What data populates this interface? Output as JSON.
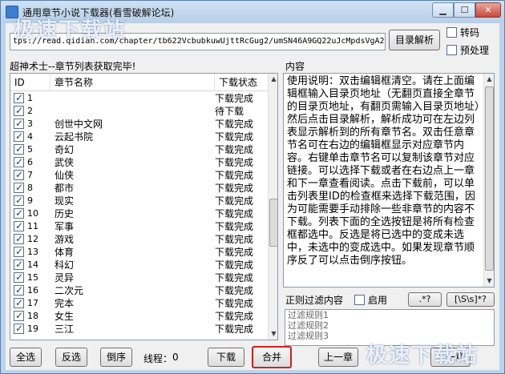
{
  "window": {
    "title": "通用章节小说下载器(看雪破解论坛)",
    "watermark": "极速下载站"
  },
  "url": {
    "value": "tps://read.qidian.com/chapter/tb622VcbubkuwUjttRcGug2/umSN46A9GQ22uJcMpdsVgA2"
  },
  "buttons": {
    "parse": "目录解析",
    "select_all": "全选",
    "invert": "反选",
    "reverse": "倒序",
    "download": "下载",
    "merge": "合并",
    "prev_chapter": "上一章",
    "next_chapter": "下一章",
    "regex_any": ".*?",
    "regex_ws": "[\\S\\s]*?"
  },
  "options": {
    "transcode": "转码",
    "preprocess": "预处理",
    "enable": "启用"
  },
  "status": {
    "message": "超神术士--章节列表获取完毕!",
    "threads_label": "线程：",
    "threads_value": "0"
  },
  "chapter_list": {
    "headers": {
      "id": "ID",
      "name": "章节名称",
      "status": "下载状态"
    },
    "rows": [
      {
        "id": "1",
        "name": "",
        "status": "下载完成",
        "checked": true
      },
      {
        "id": "2",
        "name": "",
        "status": "待下载",
        "checked": true
      },
      {
        "id": "3",
        "name": "创世中文网",
        "status": "下载完成",
        "checked": true
      },
      {
        "id": "4",
        "name": "云起书院",
        "status": "下载完成",
        "checked": true
      },
      {
        "id": "5",
        "name": "奇幻",
        "status": "下载完成",
        "checked": true
      },
      {
        "id": "6",
        "name": "武侠",
        "status": "下载完成",
        "checked": true
      },
      {
        "id": "7",
        "name": "仙侠",
        "status": "下载完成",
        "checked": true
      },
      {
        "id": "8",
        "name": "都市",
        "status": "下载完成",
        "checked": true
      },
      {
        "id": "9",
        "name": "现实",
        "status": "下载完成",
        "checked": true
      },
      {
        "id": "10",
        "name": "历史",
        "status": "下载完成",
        "checked": true
      },
      {
        "id": "11",
        "name": "军事",
        "status": "下载完成",
        "checked": true
      },
      {
        "id": "12",
        "name": "游戏",
        "status": "下载完成",
        "checked": true
      },
      {
        "id": "13",
        "name": "体育",
        "status": "下载完成",
        "checked": true
      },
      {
        "id": "14",
        "name": "科幻",
        "status": "下载完成",
        "checked": true
      },
      {
        "id": "15",
        "name": "灵异",
        "status": "下载完成",
        "checked": true
      },
      {
        "id": "16",
        "name": "二次元",
        "status": "下载完成",
        "checked": true
      },
      {
        "id": "17",
        "name": "完本",
        "status": "下载完成",
        "checked": true
      },
      {
        "id": "18",
        "name": "女生",
        "status": "下载完成",
        "checked": true
      },
      {
        "id": "19",
        "name": "三江",
        "status": "下载完成",
        "checked": true
      }
    ]
  },
  "content": {
    "label": "内容",
    "text": "使用说明：双击编辑框清空。请在上面编辑框输入目录页地址（无翻页直接全章节的目录页地址，有翻页需输入目录页地址）然后点击目录解析，解析成功可在左边列表显示解析到的所有章节名。双击任意章节名可在右边的编辑框显示对应章节内容。右键单击章节名可以复制该章节对应链接。可以选择下载或者在右边点上一章和下一章查看阅读。点击下载前，可以单击列表里ID的检查框来选择下载范围，因为可能需要手动排除一些非章节的内容不下载。列表下面的全选按钮是将所有检查框都选中。反选是将已选中的变成未选中，未选中的变成选中。如果发现章节顺序反了可以点击倒序按钮。"
  },
  "filter": {
    "label": "正则过滤内容",
    "rules": [
      "过滤规则1",
      "过滤规则2",
      "过滤规则3"
    ]
  },
  "colors": {
    "merge_highlight": "#d21f1f",
    "title_bar": "#bcd3ea"
  }
}
